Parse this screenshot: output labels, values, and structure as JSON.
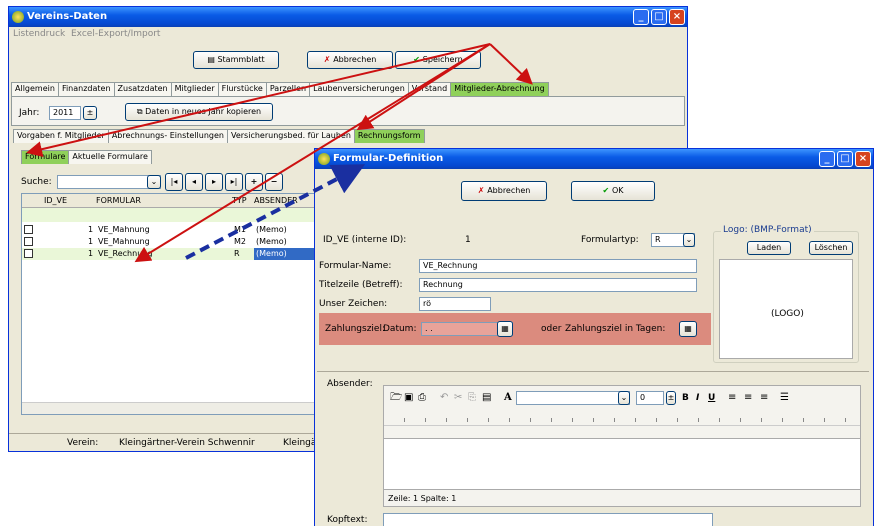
{
  "main_window": {
    "title": "Vereins-Daten",
    "menu": [
      "Listendruck",
      "Excel-Export/Import"
    ],
    "buttons": {
      "stammblatt": "Stammblatt",
      "abbrechen": "Abbrechen",
      "speichern": "Speichern"
    },
    "tabs": [
      "Allgemein",
      "Finanzdaten",
      "Zusatzdaten",
      "Mitglieder",
      "Flurstücke",
      "Parzellen",
      "Laubenversicherungen",
      "Vorstand",
      "Mitglieder-Abrechnung"
    ],
    "jahr_label": "Jahr:",
    "jahr_value": "2011",
    "copy_button": "Daten in neues Jahr kopieren",
    "subtabs": [
      "Vorgaben f. Mitglieder",
      "Abrechnungs- Einstellungen",
      "Versicherungsbed. für Lauben",
      "Rechnungsform"
    ],
    "subsubtabs": [
      "Formulare",
      "Aktuelle Formulare"
    ],
    "search_label": "Suche:",
    "nav_buttons": [
      "|◂",
      "◂",
      "▸",
      "▸|",
      "+",
      "−"
    ],
    "columns": [
      "ID_VE",
      "FORMULAR",
      "TYP",
      "ABSENDER"
    ],
    "rows": [
      {
        "id": "1",
        "formular": "VE_Mahnung",
        "typ": "M1",
        "absender": "(Memo)"
      },
      {
        "id": "1",
        "formular": "VE_Mahnung",
        "typ": "M2",
        "absender": "(Memo)"
      },
      {
        "id": "1",
        "formular": "VE_Rechnung",
        "typ": "R",
        "absender": "(Memo)"
      }
    ],
    "status": {
      "label": "Verein:",
      "value": "Kleingärtner-Verein Schwennir",
      "extra": "Kleingär"
    }
  },
  "dialog": {
    "title": "Formular-Definition",
    "buttons": {
      "abbrechen": "Abbrechen",
      "ok": "OK"
    },
    "id_label": "ID_VE (interne ID):",
    "id_value": "1",
    "typ_label": "Formulartyp:",
    "typ_value": "R",
    "name_label": "Formular-Name:",
    "name_value": "VE_Rechnung",
    "titel_label": "Titelzeile (Betreff):",
    "titel_value": "Rechnung",
    "zeichen_label": "Unser Zeichen:",
    "zeichen_value": "rö",
    "zahlungsziel_label": "Zahlungsziel:",
    "datum_label": "Datum:",
    "datum_value": ". .",
    "oder_label": "oder",
    "tage_label": "Zahlungsziel in Tagen:",
    "logo_title": "Logo: (BMP-Format)",
    "laden": "Laden",
    "loeschen": "Löschen",
    "logo_placeholder": "(LOGO)",
    "absender_label": "Absender:",
    "font_size": "0",
    "editor_status": "Zeile:  1   Spalte:  1",
    "kopftext_label": "Kopftext:"
  },
  "colors": {
    "highlight": "#d87a6e",
    "active_tab": "#8fd05a",
    "arrow_red": "#cc1111",
    "arrow_blue": "#1a2fa0"
  }
}
